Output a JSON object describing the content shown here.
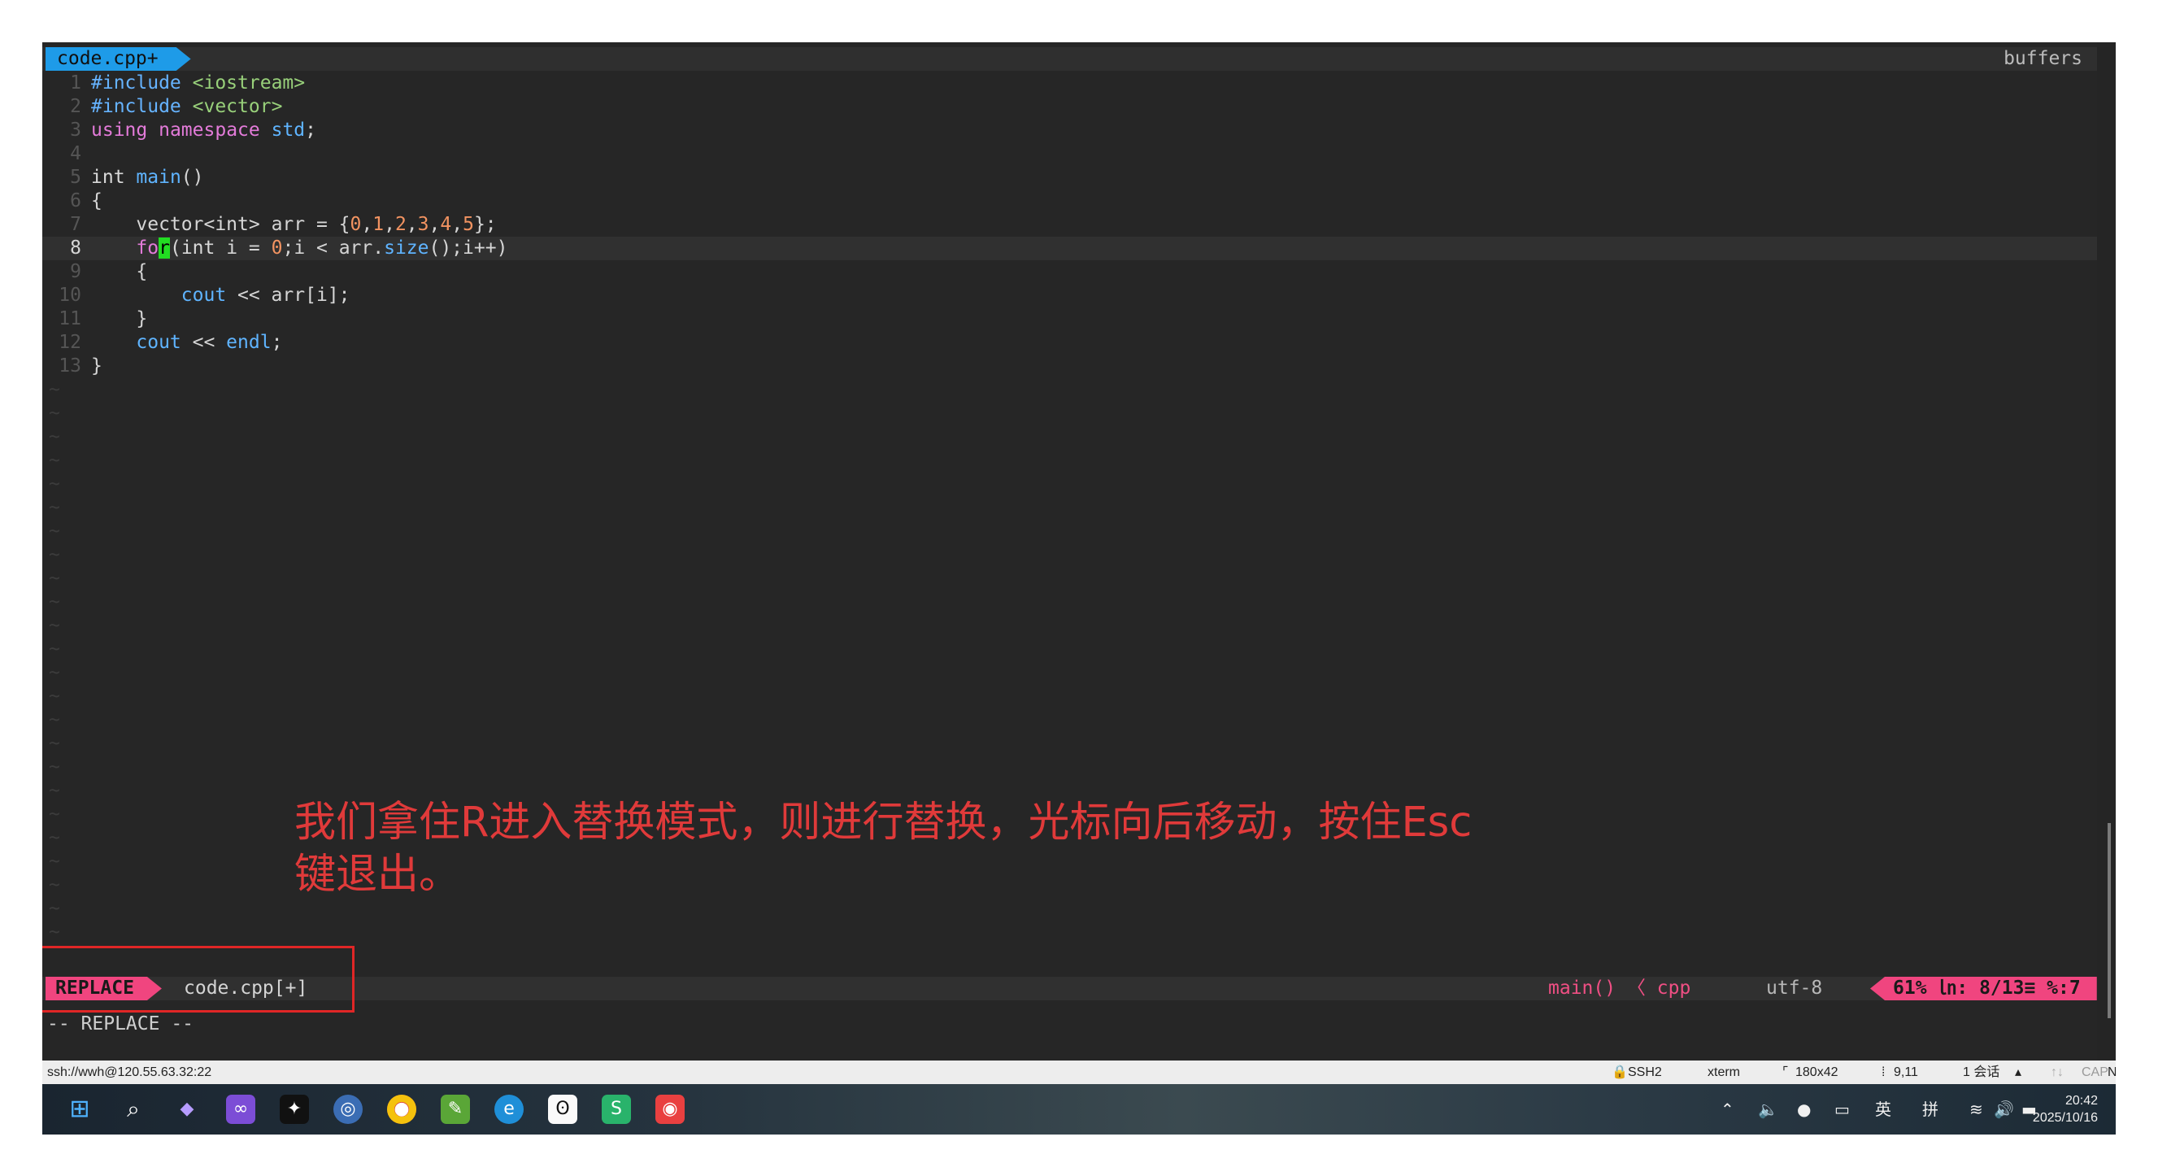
{
  "tabline": {
    "tab_label": "code.cpp+",
    "right_label": "buffers"
  },
  "code_lines": [
    {
      "n": "1",
      "parts": [
        {
          "t": "#include",
          "c": "pre"
        },
        {
          "t": " ",
          "c": ""
        },
        {
          "t": "<iostream>",
          "c": "inc"
        }
      ]
    },
    {
      "n": "2",
      "parts": [
        {
          "t": "#include",
          "c": "pre"
        },
        {
          "t": " ",
          "c": ""
        },
        {
          "t": "<vector>",
          "c": "inc"
        }
      ]
    },
    {
      "n": "3",
      "parts": [
        {
          "t": "using",
          "c": "kw"
        },
        {
          "t": " ",
          "c": ""
        },
        {
          "t": "namespace",
          "c": "kw"
        },
        {
          "t": " ",
          "c": ""
        },
        {
          "t": "std",
          "c": "ns"
        },
        {
          "t": ";",
          "c": ""
        }
      ]
    },
    {
      "n": "4",
      "parts": []
    },
    {
      "n": "5",
      "parts": [
        {
          "t": "int",
          "c": "ty"
        },
        {
          "t": " ",
          "c": ""
        },
        {
          "t": "main",
          "c": "fn"
        },
        {
          "t": "()",
          "c": ""
        }
      ]
    },
    {
      "n": "6",
      "parts": [
        {
          "t": "{",
          "c": ""
        }
      ]
    },
    {
      "n": "7",
      "parts": [
        {
          "t": "    vector<",
          "c": ""
        },
        {
          "t": "int",
          "c": "ty"
        },
        {
          "t": "> arr = {",
          "c": ""
        },
        {
          "t": "0",
          "c": "num"
        },
        {
          "t": ",",
          "c": ""
        },
        {
          "t": "1",
          "c": "num"
        },
        {
          "t": ",",
          "c": ""
        },
        {
          "t": "2",
          "c": "num"
        },
        {
          "t": ",",
          "c": ""
        },
        {
          "t": "3",
          "c": "num"
        },
        {
          "t": ",",
          "c": ""
        },
        {
          "t": "4",
          "c": "num"
        },
        {
          "t": ",",
          "c": ""
        },
        {
          "t": "5",
          "c": "num"
        },
        {
          "t": "};",
          "c": ""
        }
      ]
    },
    {
      "n": "8",
      "cur": true,
      "parts": [
        {
          "t": "    ",
          "c": ""
        },
        {
          "t": "fo",
          "c": "kw"
        },
        {
          "t": "r",
          "c": "cursor"
        },
        {
          "t": "(",
          "c": ""
        },
        {
          "t": "int",
          "c": "ty"
        },
        {
          "t": " i = ",
          "c": ""
        },
        {
          "t": "0",
          "c": "num"
        },
        {
          "t": ";i < arr.",
          "c": ""
        },
        {
          "t": "size",
          "c": "fn"
        },
        {
          "t": "();i++)",
          "c": ""
        }
      ]
    },
    {
      "n": "9",
      "parts": [
        {
          "t": "    {",
          "c": ""
        }
      ]
    },
    {
      "n": "10",
      "parts": [
        {
          "t": "        ",
          "c": ""
        },
        {
          "t": "cout",
          "c": "fn"
        },
        {
          "t": " << arr[i];",
          "c": ""
        }
      ]
    },
    {
      "n": "11",
      "parts": [
        {
          "t": "    }",
          "c": ""
        }
      ]
    },
    {
      "n": "12",
      "parts": [
        {
          "t": "    ",
          "c": ""
        },
        {
          "t": "cout",
          "c": "fn"
        },
        {
          "t": " << ",
          "c": ""
        },
        {
          "t": "endl",
          "c": "fn"
        },
        {
          "t": ";",
          "c": ""
        }
      ]
    },
    {
      "n": "13",
      "parts": [
        {
          "t": "}",
          "c": ""
        }
      ]
    }
  ],
  "empty_line_marker": "~",
  "empty_line_count": 24,
  "annotation": {
    "line1": "我们拿住R进入替换模式，则进行替换，光标向后移动，按住Esc",
    "line2": "键退出。"
  },
  "statusline": {
    "mode": "REPLACE",
    "filename": "code.cpp[+]",
    "function": "main() 〈 cpp",
    "encoding": "utf-8",
    "position": "61% ㏑: 8/13≡ %:7"
  },
  "cmdline": "-- REPLACE --",
  "ssh_bar": {
    "address": "ssh://wwh@120.55.63.32:22",
    "protocol": "SSH2",
    "terminal": "xterm",
    "size": "180x42",
    "cursor_pos": "9,11",
    "sessions": "1 会话",
    "caps": "CAP",
    "num": "NUM"
  },
  "taskbar": {
    "apps": [
      "windows-start",
      "search",
      "bird-app",
      "visual-studio",
      "game-app",
      "chrome-ui-app",
      "chrome",
      "notepad",
      "edge",
      "panda-app",
      "wechat-app",
      "wps-app"
    ],
    "ime_lang": "英",
    "ime_mode": "拼",
    "time": "20:42",
    "date": "2025/10/16"
  },
  "colors": {
    "tab": "#1e9be8",
    "mode": "#f0457f",
    "annotation": "#e03a3a",
    "cursor": "#22dd22",
    "redbox": "#e02626"
  }
}
